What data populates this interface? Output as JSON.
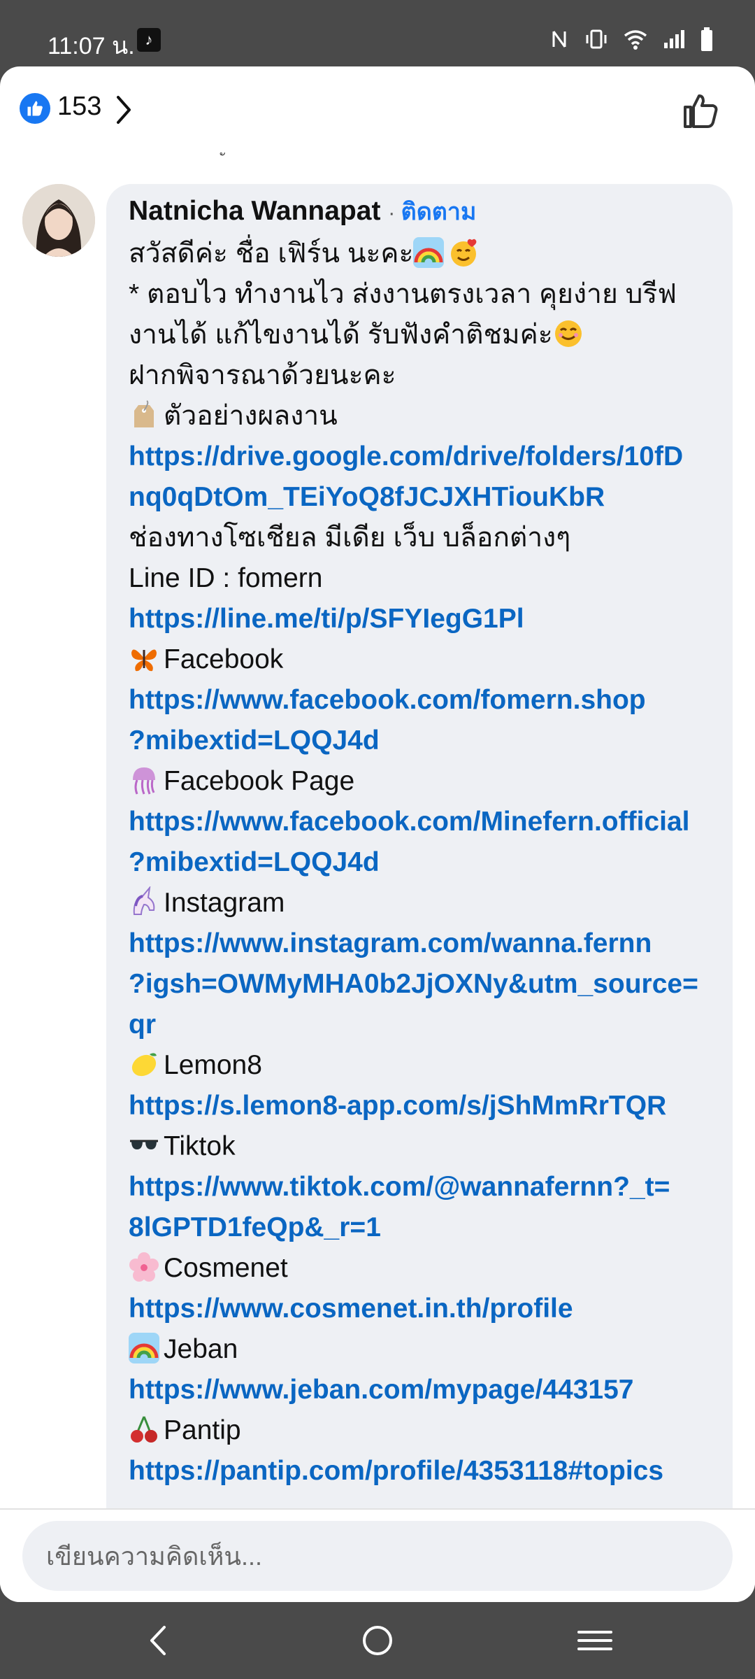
{
  "status": {
    "time": "11:07 น."
  },
  "reactions": {
    "count": "153"
  },
  "stray_char": "ั",
  "comment": {
    "author": "Natnicha Wannapat",
    "follow_label": "ติดตาม",
    "lines": {
      "greeting": "สวัสดีค่ะ ชื่อ เฟิร์น นะคะ",
      "desc1": "* ตอบไว ทำงานไว ส่งงานตรงเวลา คุยง่าย บรีฟ",
      "desc2": "งานได้ แก้ไขงานได้ รับฟังคำติชมค่ะ",
      "desc3": "ฝากพิจารณาด้วยนะคะ",
      "portfolio_label": "ตัวอย่างผลงาน",
      "portfolio_link": "https://drive.google.com/drive/folders/10fDnq0qDtOm_TEiYoQ8fJCJXHTiouKbR",
      "social_label": "ช่องทางโซเชียล มีเดีย เว็บ บล็อกต่างๆ",
      "line_id": "Line ID : fomern",
      "line_link": "https://line.me/ti/p/SFYIegG1Pl",
      "facebook_label": "Facebook",
      "facebook_link1": "https://www.facebook.com/fomern.shop",
      "facebook_link2": "?mibextid=LQQJ4d",
      "fbpage_label": "Facebook Page",
      "fbpage_link1": "https://www.facebook.com/Minefern.official",
      "fbpage_link2": "?mibextid=LQQJ4d",
      "instagram_label": "Instagram",
      "instagram_link1": "https://www.instagram.com/wanna.fernn",
      "instagram_link2": "?igsh=OWMyMHA0b2JjOXNy&utm_source=",
      "instagram_link3": "qr",
      "lemon8_label": "Lemon8",
      "lemon8_link": "https://s.lemon8-app.com/s/jShMmRrTQR",
      "tiktok_label": "Tiktok",
      "tiktok_link1": "https://www.tiktok.com/@wannafernn?_t=",
      "tiktok_link2": "8lGPTD1feQp&_r=1",
      "cosmenet_label": "Cosmenet",
      "cosmenet_link": "https://www.cosmenet.in.th/profile",
      "jeban_label": "Jeban",
      "jeban_link": "https://www.jeban.com/mypage/443157",
      "pantip_label": "Pantip",
      "pantip_link": "https://pantip.com/profile/4353118#topics"
    }
  },
  "composer": {
    "placeholder": "เขียนความคิดเห็น..."
  },
  "colors": {
    "link": "#0a66c2",
    "follow": "#1877f2",
    "bubble": "#eef0f4"
  }
}
